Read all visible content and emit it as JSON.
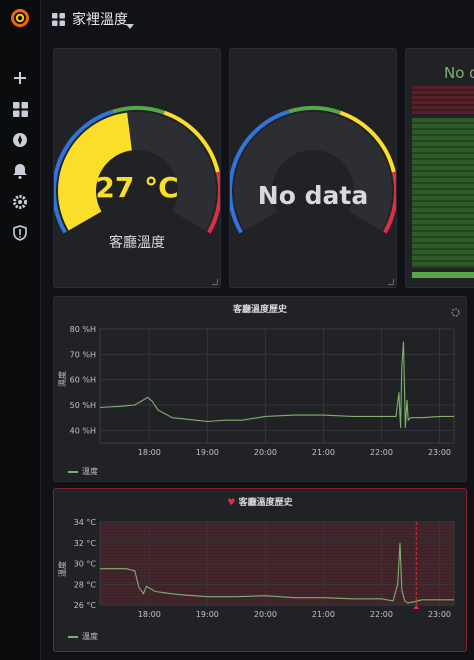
{
  "header": {
    "title": "家裡溫度"
  },
  "sidebar": {
    "logo_icon": "grafana-logo",
    "items": [
      "plus-icon",
      "dashboards-icon",
      "explore-icon",
      "alerting-icon",
      "gear-icon",
      "shield-icon"
    ]
  },
  "gauges": [
    {
      "value": "27 °C",
      "label": "客廳溫度",
      "fill_fraction": 0.47
    },
    {
      "value": "No data",
      "label": ""
    }
  ],
  "partial_panel": {
    "text": "No d"
  },
  "humidity_panel": {
    "title": "客廳溫度歷史",
    "ylabel": "濕度",
    "legend": "溫度"
  },
  "temp_panel": {
    "title": "客廳溫度歷史",
    "ylabel": "溫度",
    "legend": "溫度"
  },
  "chart_data": [
    {
      "type": "line",
      "title": "客廳溫度歷史",
      "ylabel": "濕度",
      "yticks": [
        "40 %H",
        "50 %H",
        "60 %H",
        "70 %H",
        "80 %H"
      ],
      "xticks": [
        "18:00",
        "19:00",
        "20:00",
        "21:00",
        "22:00",
        "23:00"
      ],
      "ylim": [
        35,
        80
      ],
      "xlim": [
        17.15,
        23.25
      ],
      "series": [
        {
          "name": "溫度",
          "x": [
            17.15,
            17.5,
            17.75,
            17.9,
            17.97,
            18.05,
            18.15,
            18.4,
            18.8,
            19.0,
            19.3,
            19.6,
            20.0,
            20.5,
            21.0,
            21.5,
            22.0,
            22.25,
            22.3,
            22.33,
            22.35,
            22.38,
            22.41,
            22.44,
            22.46,
            22.5,
            22.7,
            23.0,
            23.25
          ],
          "values": [
            49,
            49.5,
            50,
            52,
            53,
            51.5,
            48,
            45,
            44,
            43.5,
            44,
            44,
            45.5,
            46,
            46,
            45.5,
            45.5,
            45.5,
            55,
            41,
            65,
            75,
            41,
            52,
            44,
            45,
            45,
            45.5,
            45.5
          ]
        }
      ]
    },
    {
      "type": "line",
      "title": "客廳溫度歷史",
      "ylabel": "溫度",
      "yticks": [
        "26 °C",
        "28 °C",
        "30 °C",
        "32 °C",
        "34 °C"
      ],
      "xticks": [
        "18:00",
        "19:00",
        "20:00",
        "21:00",
        "22:00",
        "23:00"
      ],
      "ylim": [
        26,
        34
      ],
      "xlim": [
        17.15,
        23.25
      ],
      "threshold": 26,
      "series": [
        {
          "name": "溫度",
          "x": [
            17.15,
            17.6,
            17.75,
            17.82,
            17.9,
            17.95,
            18.1,
            18.5,
            19.0,
            19.5,
            20.0,
            20.5,
            21.0,
            21.5,
            22.0,
            22.2,
            22.28,
            22.32,
            22.35,
            22.4,
            22.45,
            22.55,
            22.7,
            23.0,
            23.25
          ],
          "values": [
            29.5,
            29.5,
            29.3,
            27.7,
            27.1,
            27.8,
            27.3,
            27.0,
            26.8,
            26.8,
            26.9,
            26.7,
            26.7,
            26.6,
            26.6,
            26.4,
            28.0,
            32.0,
            27.5,
            26.4,
            26.2,
            26.3,
            26.5,
            26.5,
            26.5
          ]
        }
      ]
    }
  ],
  "colors": {
    "accent_green": "#7eb26d",
    "gauge_yellow": "#fade2a",
    "gauge_blue": "#3274d9",
    "gauge_green": "#56a64b",
    "gauge_red": "#e02f44",
    "alert_red": "#e02f44"
  }
}
